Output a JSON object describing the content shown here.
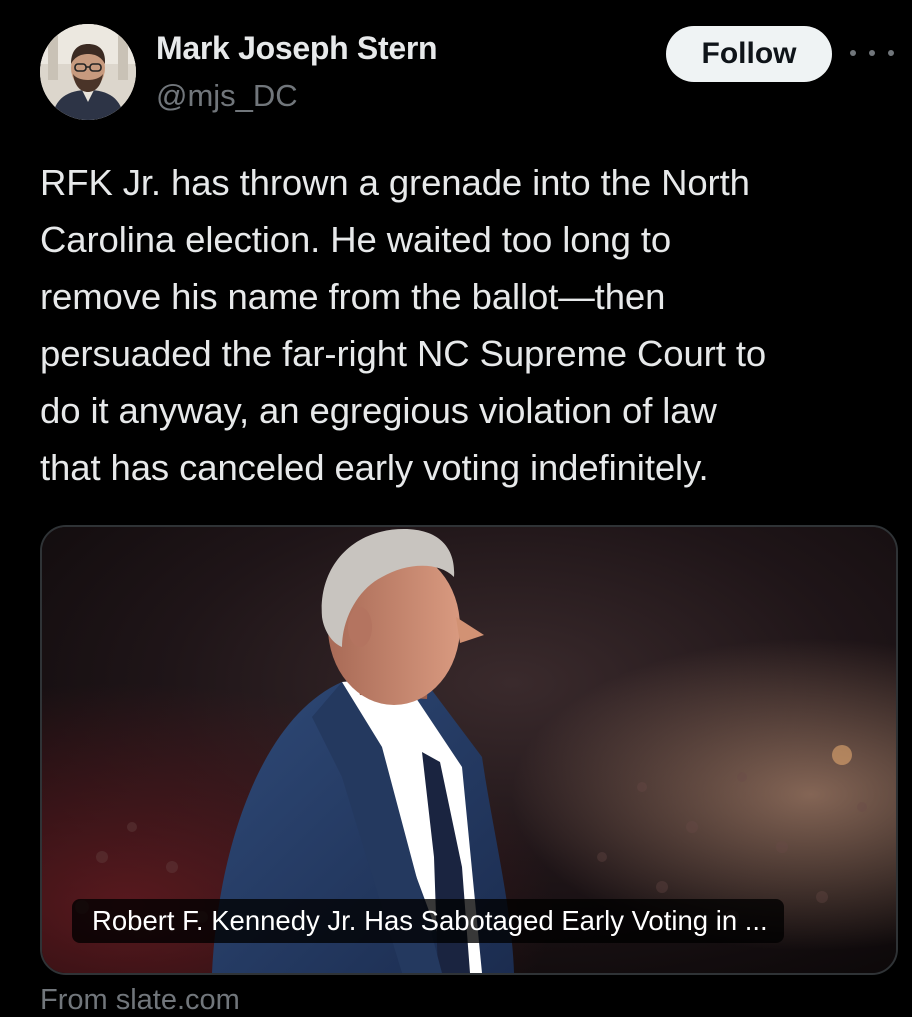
{
  "author": {
    "display_name": "Mark Joseph Stern",
    "handle": "@mjs_DC"
  },
  "actions": {
    "follow_label": "Follow",
    "more_icon": "more-horizontal-icon"
  },
  "tweet": {
    "lines": [
      "RFK Jr. has thrown a grenade into the North",
      "Carolina election. He waited too long to",
      "remove his name from the ballot—then",
      "persuaded the far-right NC Supreme Court to",
      "do it anyway, an egregious violation of law",
      "that has canceled early voting indefinitely."
    ]
  },
  "card": {
    "title": "Robert F. Kennedy Jr. Has Sabotaged Early Voting in ...",
    "source": "From slate.com"
  },
  "colors": {
    "background": "#000000",
    "text_primary": "#e7e9ea",
    "text_secondary": "#71767b",
    "follow_bg": "#eff3f4",
    "card_border": "#2f3336"
  }
}
